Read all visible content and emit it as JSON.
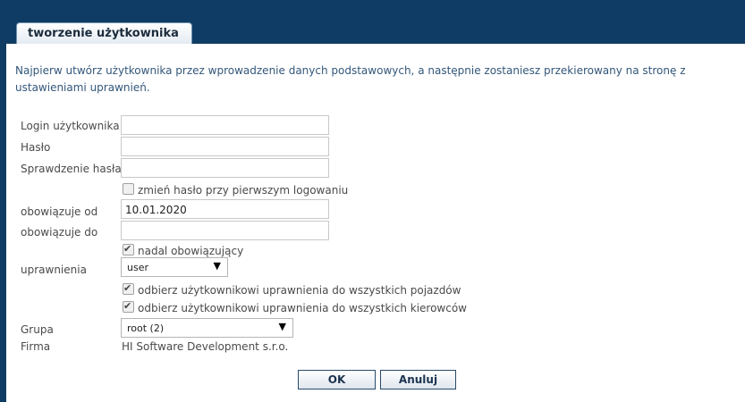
{
  "tab": {
    "title": "tworzenie użytkownika"
  },
  "intro": "Najpierw utwórz użytkownika przez wprowadzenie danych podstawowych, a następnie zostaniesz przekierowany na stronę z ustawieniami uprawnień.",
  "form": {
    "login": {
      "label": "Login użytkownika",
      "value": ""
    },
    "password": {
      "label": "Hasło",
      "value": ""
    },
    "password_confirm": {
      "label": "Sprawdzenie hasła",
      "value": ""
    },
    "change_password_checkbox": {
      "label": "zmień hasło przy pierwszym logowaniu",
      "checked": false
    },
    "valid_from": {
      "label": "obowiązuje od",
      "value": "10.01.2020"
    },
    "valid_to": {
      "label": "obowiązuje do",
      "value": ""
    },
    "still_valid_checkbox": {
      "label": "nadal obowiązujący",
      "checked": true
    },
    "permissions": {
      "label": "uprawnienia",
      "selected": "user"
    },
    "revoke_vehicles_checkbox": {
      "label": "odbierz użytkownikowi uprawnienia do wszystkich pojazdów",
      "checked": true
    },
    "revoke_drivers_checkbox": {
      "label": "odbierz użytkownikowi uprawnienia do wszystkich kierowców",
      "checked": true
    },
    "group": {
      "label": "Grupa",
      "selected": "root (2)"
    },
    "company": {
      "label": "Firma",
      "value": "HI Software Development s.r.o."
    }
  },
  "buttons": {
    "ok": "OK",
    "cancel": "Anuluj"
  },
  "icons": {
    "dropdown": "dropdown-arrow-icon",
    "check": "checkmark-icon"
  },
  "colors": {
    "background": "#0e3c64",
    "panel": "#ffffff",
    "intro_text": "#33577a"
  }
}
